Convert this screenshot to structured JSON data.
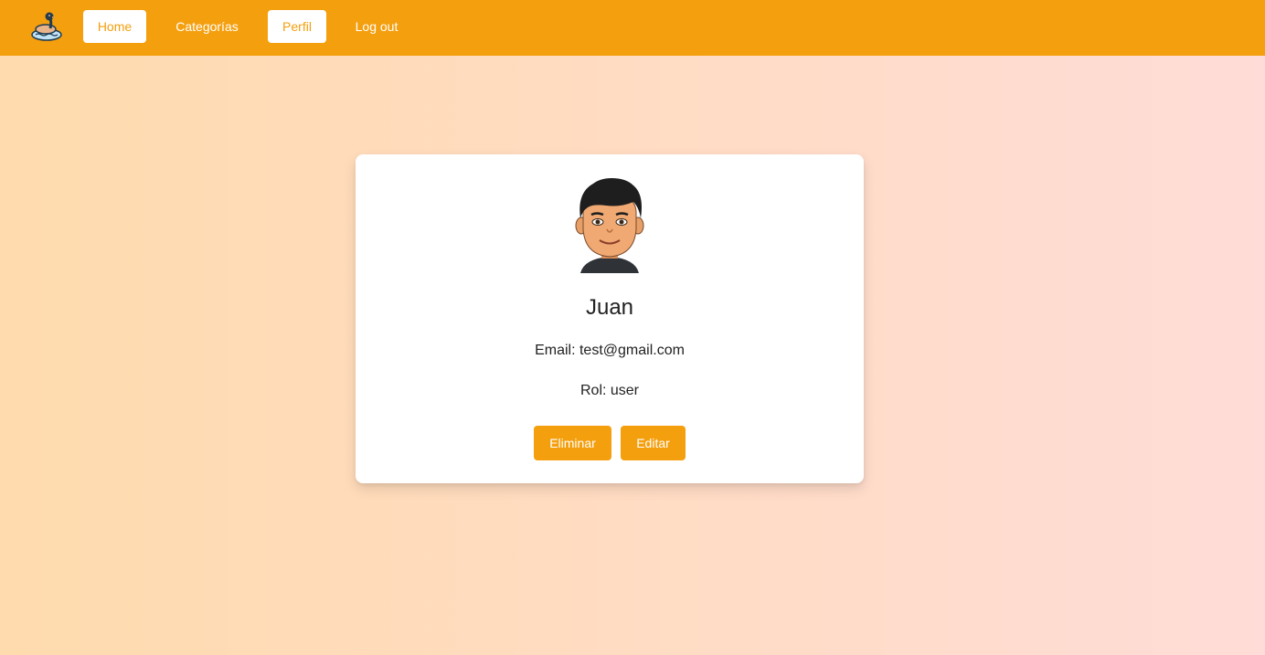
{
  "navbar": {
    "logo_icon": "duck-on-water-icon",
    "items": [
      {
        "label": "Home",
        "active": true
      },
      {
        "label": "Categorías",
        "active": false
      },
      {
        "label": "Perfil",
        "active": true
      },
      {
        "label": "Log out",
        "active": false
      }
    ]
  },
  "profile": {
    "avatar_icon": "user-avatar-icon",
    "name": "Juan",
    "email_text": "Email: test@gmail.com",
    "rol_text": "Rol: user",
    "delete_label": "Eliminar",
    "edit_label": "Editar"
  },
  "colors": {
    "accent": "#f49f0e",
    "background_left": "#ffdbae",
    "background_right": "#ffdcd7"
  }
}
